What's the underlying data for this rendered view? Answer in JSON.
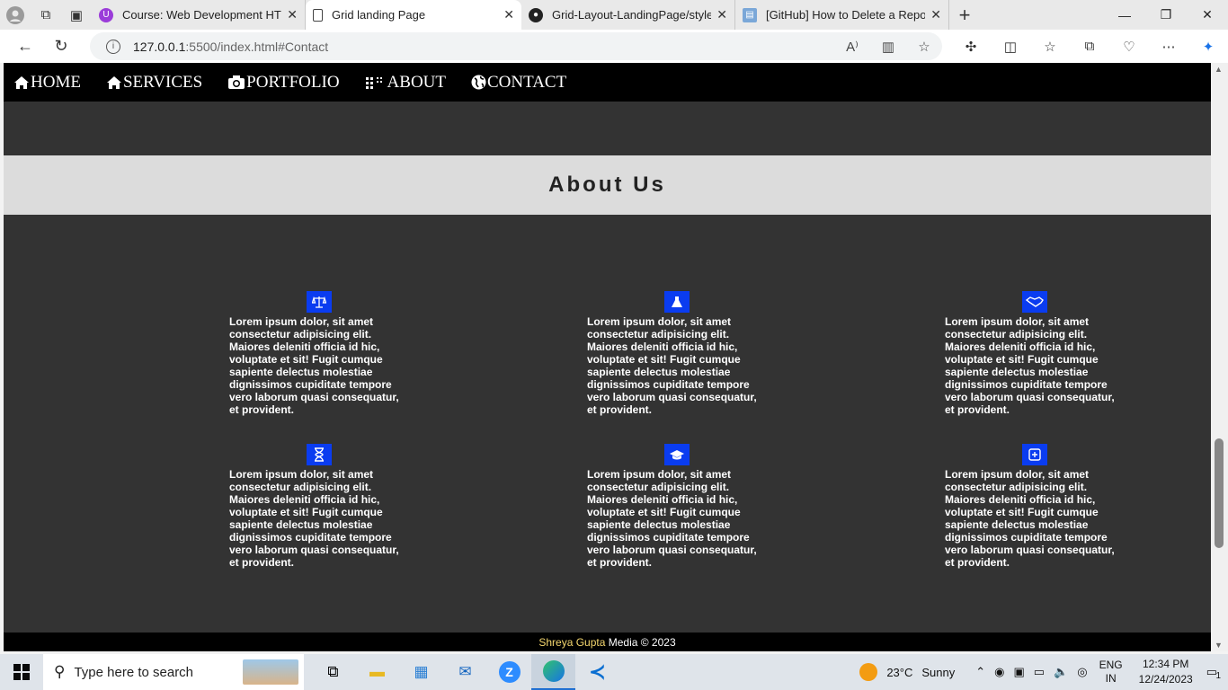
{
  "browser": {
    "tabs": [
      {
        "title": "Course: Web Development HTML",
        "fav_color": "#9b3cd9",
        "active": false
      },
      {
        "title": "Grid landing Page",
        "fav_color": "#ffffff",
        "active": true
      },
      {
        "title": "Grid-Layout-LandingPage/style.c",
        "fav_color": "#222222",
        "active": false
      },
      {
        "title": "[GitHub] How to Delete a Reposit",
        "fav_color": "#7aa7d8",
        "active": false
      }
    ],
    "url_host": "127.0.0.1",
    "url_rest": ":5500/index.html#Contact"
  },
  "site": {
    "nav": [
      {
        "label": "HOME",
        "icon": "home-icon"
      },
      {
        "label": "SERVICES",
        "icon": "home-icon"
      },
      {
        "label": "PORTFOLIO",
        "icon": "camera-icon"
      },
      {
        "label": "ABOUT",
        "icon": "grid-icon"
      },
      {
        "label": "CONTACT",
        "icon": "globe-icon"
      }
    ],
    "about_title": "About Us",
    "cards": [
      {
        "icon": "balance-scale-icon",
        "text": "Lorem ipsum dolor, sit amet consectetur adipisicing elit. Maiores deleniti officia id hic, voluptate et sit! Fugit cumque sapiente delectus molestiae dignissimos cupiditate tempore vero laborum quasi consequatur, et provident."
      },
      {
        "icon": "flask-icon",
        "text": "Lorem ipsum dolor, sit amet consectetur adipisicing elit. Maiores deleniti officia id hic, voluptate et sit! Fugit cumque sapiente delectus molestiae dignissimos cupiditate tempore vero laborum quasi consequatur, et provident."
      },
      {
        "icon": "handshake-icon",
        "text": "Lorem ipsum dolor, sit amet consectetur adipisicing elit. Maiores deleniti officia id hic, voluptate et sit! Fugit cumque sapiente delectus molestiae dignissimos cupiditate tempore vero laborum quasi consequatur, et provident."
      },
      {
        "icon": "hourglass-icon",
        "text": "Lorem ipsum dolor, sit amet consectetur adipisicing elit. Maiores deleniti officia id hic, voluptate et sit! Fugit cumque sapiente delectus molestiae dignissimos cupiditate tempore vero laborum quasi consequatur, et provident."
      },
      {
        "icon": "graduation-cap-icon",
        "text": "Lorem ipsum dolor, sit amet consectetur adipisicing elit. Maiores deleniti officia id hic, voluptate et sit! Fugit cumque sapiente delectus molestiae dignissimos cupiditate tempore vero laborum quasi consequatur, et provident."
      },
      {
        "icon": "plus-square-icon",
        "text": "Lorem ipsum dolor, sit amet consectetur adipisicing elit. Maiores deleniti officia id hic, voluptate et sit! Fugit cumque sapiente delectus molestiae dignissimos cupiditate tempore vero laborum quasi consequatur, et provident."
      }
    ],
    "footer": {
      "name": "Shreya Gupta",
      "rest": " Media © 2023"
    }
  },
  "taskbar": {
    "search_placeholder": "Type here to search",
    "temperature": "23°C",
    "weather": "Sunny",
    "lang1": "ENG",
    "lang2": "IN",
    "time": "12:34 PM",
    "date": "12/24/2023",
    "notifications": "1"
  }
}
